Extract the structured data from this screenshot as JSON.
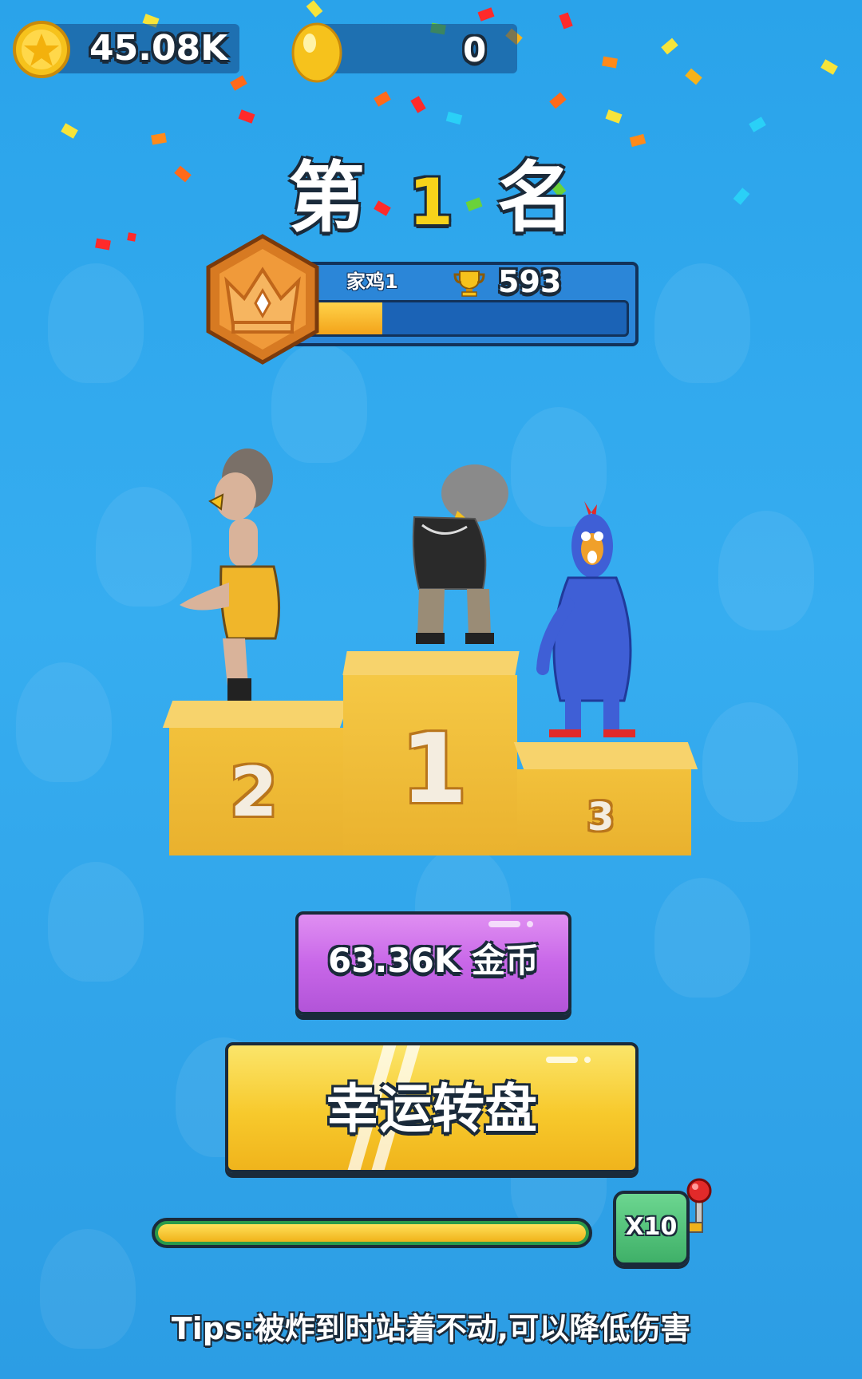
{
  "top_bar": {
    "coins": {
      "icon": "star-coin-icon",
      "value": "45.08K"
    },
    "gems": {
      "icon": "gold-egg-icon",
      "value": "0"
    }
  },
  "rank_title": {
    "prefix": "第",
    "number": "1",
    "suffix": "名"
  },
  "player": {
    "badge_icon": "crown-badge-icon",
    "name": "家鸡1",
    "trophy_icon": "trophy-icon",
    "trophies": "593",
    "progress": 0.24
  },
  "podium": {
    "first": "1",
    "second": "2",
    "third": "3"
  },
  "reward_button": {
    "label": "63.36K 金币"
  },
  "lucky_wheel_button": {
    "label": "幸运转盘"
  },
  "multiplier": {
    "progress": 1.0,
    "label": "X10"
  },
  "tips": "Tips:被炸到时站着不动,可以降低伤害",
  "colors": {
    "background": "#2ea6ec",
    "reward_button": "#c768e8",
    "lucky_button": "#f7c92c",
    "progress_fill": "#f7c32a",
    "multiplier_button": "#4fc27a"
  }
}
